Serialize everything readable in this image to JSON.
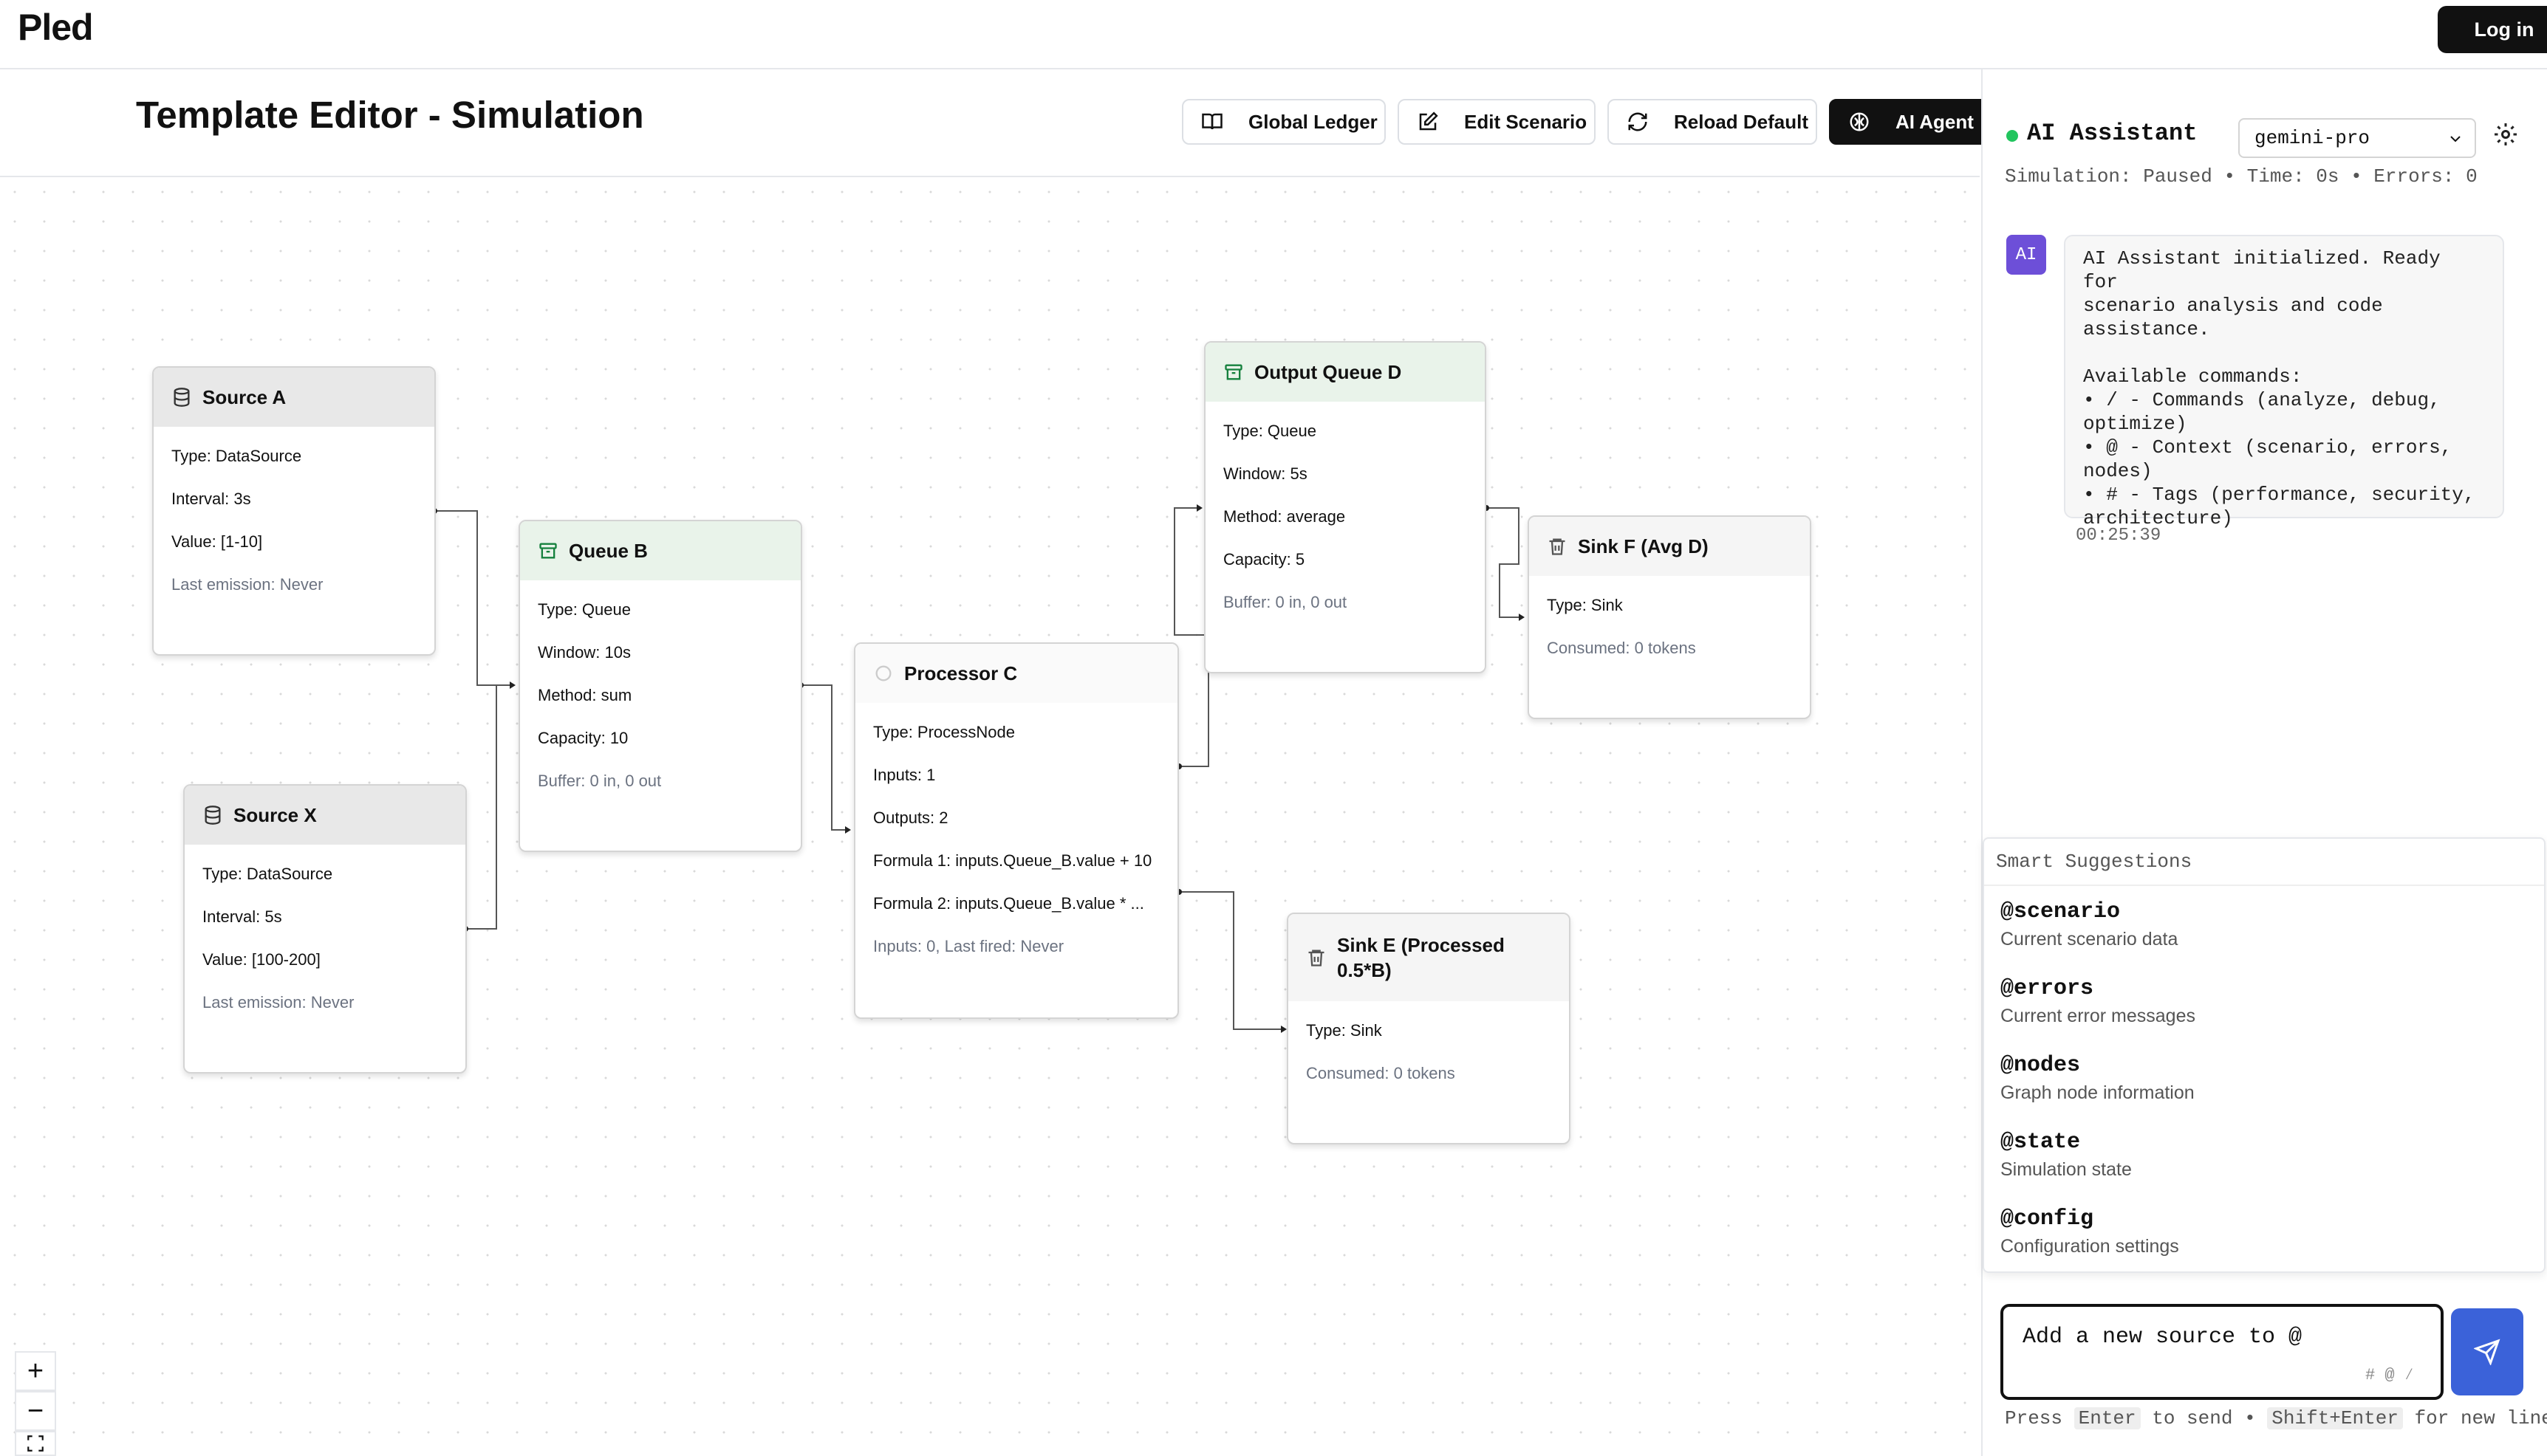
{
  "app": {
    "name": "Pled",
    "login_label": "Log in"
  },
  "header": {
    "title": "Template Editor - Simulation",
    "buttons": {
      "ledger": "Global Ledger",
      "edit": "Edit Scenario",
      "reload": "Reload Default",
      "agent": "AI Agent"
    }
  },
  "nodes": {
    "source_a": {
      "title": "Source A",
      "lines": [
        "Type: DataSource",
        "Interval: 3s",
        "Value: [1-10]",
        "Last emission: Never"
      ]
    },
    "source_x": {
      "title": "Source X",
      "lines": [
        "Type: DataSource",
        "Interval: 5s",
        "Value: [100-200]",
        "Last emission: Never"
      ]
    },
    "queue_b": {
      "title": "Queue B",
      "lines": [
        "Type: Queue",
        "Window: 10s",
        "Method: sum",
        "Capacity: 10",
        "Buffer: 0 in, 0 out"
      ]
    },
    "processor_c": {
      "title": "Processor C",
      "lines": [
        "Type: ProcessNode",
        "Inputs: 1",
        "Outputs: 2",
        "Formula 1: inputs.Queue_B.value + 10",
        "Formula 2: inputs.Queue_B.value * ...",
        "Inputs: 0, Last fired: Never"
      ]
    },
    "output_queue_d": {
      "title": "Output Queue D",
      "lines": [
        "Type: Queue",
        "Window: 5s",
        "Method: average",
        "Capacity: 5",
        "Buffer: 0 in, 0 out"
      ]
    },
    "sink_f": {
      "title": "Sink F (Avg D)",
      "lines": [
        "Type: Sink",
        "Consumed: 0 tokens"
      ]
    },
    "sink_e": {
      "title": "Sink E (Processed 0.5*B)",
      "lines": [
        "Type: Sink",
        "Consumed: 0 tokens"
      ]
    }
  },
  "zoom": {
    "in": "+",
    "out": "−"
  },
  "assistant": {
    "title": "AI Assistant",
    "model": "gemini-pro",
    "status": "Simulation: Paused • Time: 0s • Errors: 0",
    "avatar": "AI",
    "message": "AI Assistant initialized. Ready for\nscenario analysis and code\nassistance.\n\nAvailable commands:\n• / - Commands (analyze, debug,\noptimize)\n• @ - Context (scenario, errors,\nnodes)\n• # - Tags (performance, security,\narchitecture)",
    "message_time": "00:25:39",
    "suggestions_title": "Smart Suggestions",
    "suggestions": [
      {
        "key": "@scenario",
        "desc": "Current scenario data"
      },
      {
        "key": "@errors",
        "desc": "Current error messages"
      },
      {
        "key": "@nodes",
        "desc": "Graph node information"
      },
      {
        "key": "@state",
        "desc": "Simulation state"
      },
      {
        "key": "@config",
        "desc": "Configuration settings"
      }
    ],
    "input_value": "Add a new source to @",
    "input_hints": "# @ ⁄",
    "footer": {
      "press": "Press",
      "enter": "Enter",
      "to_send": "to send •",
      "shift_enter": "Shift+Enter",
      "new_line": "for new line"
    }
  },
  "colors": {
    "accent": "#3b62d9",
    "avatar": "#6d4fd8",
    "status": "#22c55e",
    "queue_header": "#e9f3ea",
    "source_header": "#e8e8e8"
  }
}
